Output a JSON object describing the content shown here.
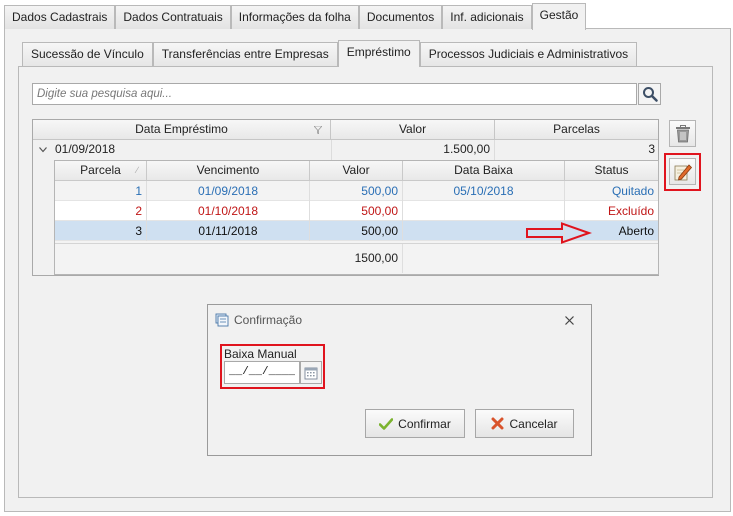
{
  "main_tabs": [
    {
      "label": "Dados Cadastrais"
    },
    {
      "label": "Dados Contratuais"
    },
    {
      "label": "Informações da folha"
    },
    {
      "label": "Documentos"
    },
    {
      "label": "Inf. adicionais"
    },
    {
      "label": "Gestão",
      "active": true
    }
  ],
  "sub_tabs": [
    {
      "label": "Sucessão de Vínculo"
    },
    {
      "label": "Transferências entre Empresas"
    },
    {
      "label": "Empréstimo",
      "active": true
    },
    {
      "label": "Processos Judiciais e Administrativos"
    }
  ],
  "search": {
    "placeholder": "Digite sua pesquisa aqui..."
  },
  "loan_grid": {
    "columns": [
      "Data Empréstimo",
      "Valor",
      "Parcelas"
    ],
    "group_row": {
      "data": "01/09/2018",
      "valor": "1.500,00",
      "parcelas": "3"
    }
  },
  "installments": {
    "columns": [
      "Parcela",
      "Vencimento",
      "Valor",
      "Data Baixa",
      "Status"
    ],
    "rows": [
      {
        "parcela": "1",
        "vencimento": "01/09/2018",
        "valor": "500,00",
        "data_baixa": "05/10/2018",
        "status": "Quitado"
      },
      {
        "parcela": "2",
        "vencimento": "01/10/2018",
        "valor": "500,00",
        "data_baixa": "",
        "status": "Excluído"
      },
      {
        "parcela": "3",
        "vencimento": "01/11/2018",
        "valor": "500,00",
        "data_baixa": "",
        "status": "Aberto"
      }
    ],
    "total": "1500,00"
  },
  "dialog": {
    "title": "Confirmação",
    "field_label": "Baixa Manual",
    "date_value": "__/__/____",
    "confirm_label": "Confirmar",
    "cancel_label": "Cancelar"
  },
  "colors": {
    "highlight": "#e0141e",
    "paid": "#2a6fb5",
    "excluded": "#c01616",
    "selected_row": "#cfe0f1"
  }
}
